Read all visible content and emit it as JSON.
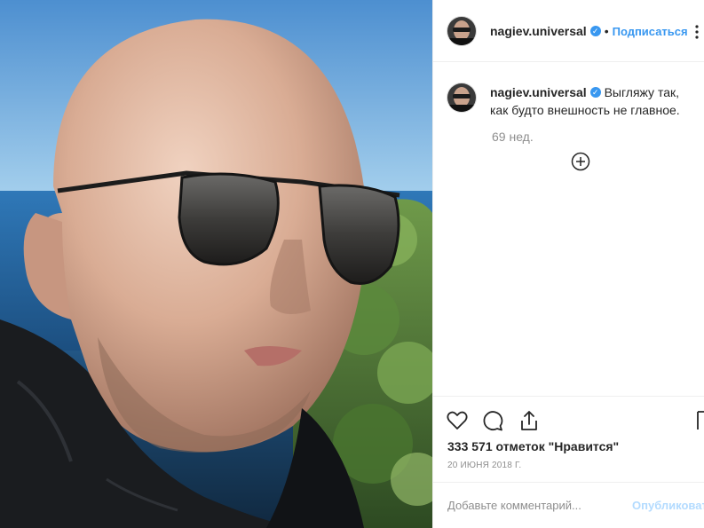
{
  "post": {
    "photo_alt": "Post photo"
  },
  "header": {
    "username": "nagiev.universal",
    "verified_icon": "verified-badge-icon",
    "separator": "•",
    "follow_label": "Подписаться",
    "more_icon": "more-options-icon"
  },
  "caption": {
    "username": "nagiev.universal",
    "text": "Выгляжу так, как будто внешность не главное.",
    "time_ago": "69 нед.",
    "load_more_icon": "plus-circle-icon"
  },
  "actions": {
    "like_icon": "heart-icon",
    "comment_icon": "comment-icon",
    "share_icon": "share-icon",
    "save_icon": "bookmark-icon"
  },
  "likes": {
    "text": "333 571 отметок \"Нравится\""
  },
  "date": {
    "text": "20 ИЮНЯ 2018 Г."
  },
  "comment": {
    "placeholder": "Добавьте комментарий...",
    "publish_label": "Опубликовать"
  },
  "colors": {
    "link_blue": "#3897f0",
    "muted_gray": "#8e8e8e",
    "publish_disabled": "#b3dbff",
    "border": "#efefef"
  }
}
